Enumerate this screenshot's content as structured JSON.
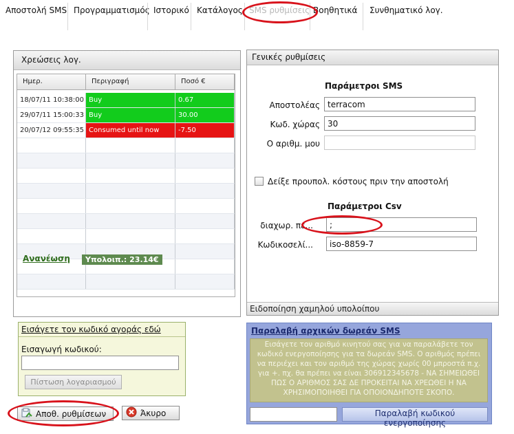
{
  "nav": {
    "tabs": [
      {
        "label": "Αποστολή SMS"
      },
      {
        "label": "Προγραμματισμός"
      },
      {
        "label": "Ιστορικό"
      },
      {
        "label": "Κατάλογος"
      },
      {
        "label": "SMS ρυθμίσεις",
        "active": true
      },
      {
        "label": "Βοηθητικά"
      },
      {
        "label": "Συνθηματικό λογ."
      }
    ]
  },
  "charges": {
    "title": "Χρεώσεις λογ.",
    "columns": [
      "Ημερ.",
      "Περιγραφή",
      "Ποσό €"
    ],
    "rows": [
      {
        "date": "18/07/11 10:38:00",
        "description": "Buy",
        "amount": "0.67",
        "color": "#12cc1c"
      },
      {
        "date": "29/07/11 15:00:33",
        "description": "Buy",
        "amount": "30.00",
        "color": "#12cc1c"
      },
      {
        "date": "20/07/12 09:55:35",
        "description": "Consumed until now",
        "amount": "-7.50",
        "color": "#e61414"
      }
    ],
    "refresh_label": "Ανανέωση",
    "balance_label": "Υπολοιπ.: 23.14€"
  },
  "settings": {
    "title": "Γενικές ρυθμίσεις",
    "sms_params_title": "Παράμετροι SMS",
    "sender_label": "Αποστολέας",
    "sender_value": "terracom",
    "country_code_label": "Κωδ. χώρας",
    "country_code_value": "30",
    "my_number_label": "Ο αριθμ. μου",
    "my_number_value": "",
    "show_cost_label": "Δείξε προυπολ. κόστους πριν την αποστολή",
    "show_cost_checked": false,
    "csv_params_title": "Παράμετροι Csv",
    "separator_label": "διαχωρ. πε...",
    "separator_value": ";",
    "encoding_label": "Κωδικοσελί...",
    "encoding_value": "iso-8859-7",
    "low_balance_label": "Ειδοποίηση χαμηλού υπολοίπου"
  },
  "coupon": {
    "link_label": "Εισάγετε τον κωδικό αγοράς εδώ",
    "input_label": "Εισαγωγή κωδικού:",
    "input_value": "",
    "credit_button_label": "Πίστωση λογαριασμού"
  },
  "actions": {
    "save_label": "Αποθ. ρυθμίσεων",
    "cancel_label": "Άκυρο"
  },
  "free_sms": {
    "title": "Παραλαβή αρχικών δωρεάν SMS",
    "message": "Εισάγετε τον αριθμό κινητού σας για να παραλάβετε τον κωδικό ενεργοποίησης για τα δωρεάν SMS. Ο αριθμός πρέπει να περιέχει και τον αριθμό της χώρας χωρίς 00 μπροστά π.χ. για +. πχ. θα πρέπει να είναι 306912345678 - ΝΑ ΣΗΜΕΙΩΘΕΙ ΠΩΣ Ο ΑΡΙΘΜΟΣ ΣΑΣ ΔΕ ΠΡΟΚΕΙΤΑΙ ΝΑ ΧΡΕΩΘΕΙ Η ΝΑ ΧΡΗΣΙΜΟΠΟΙΗΘΕΙ ΓΙΑ ΟΠΟΙΟΝΔΗΠΟΤΕ ΣΚΟΠΟ.",
    "phone_value": "",
    "button_label": "Παραλαβή κωδικού ενεργοποίησης"
  },
  "annotation_color": "#d8121b"
}
